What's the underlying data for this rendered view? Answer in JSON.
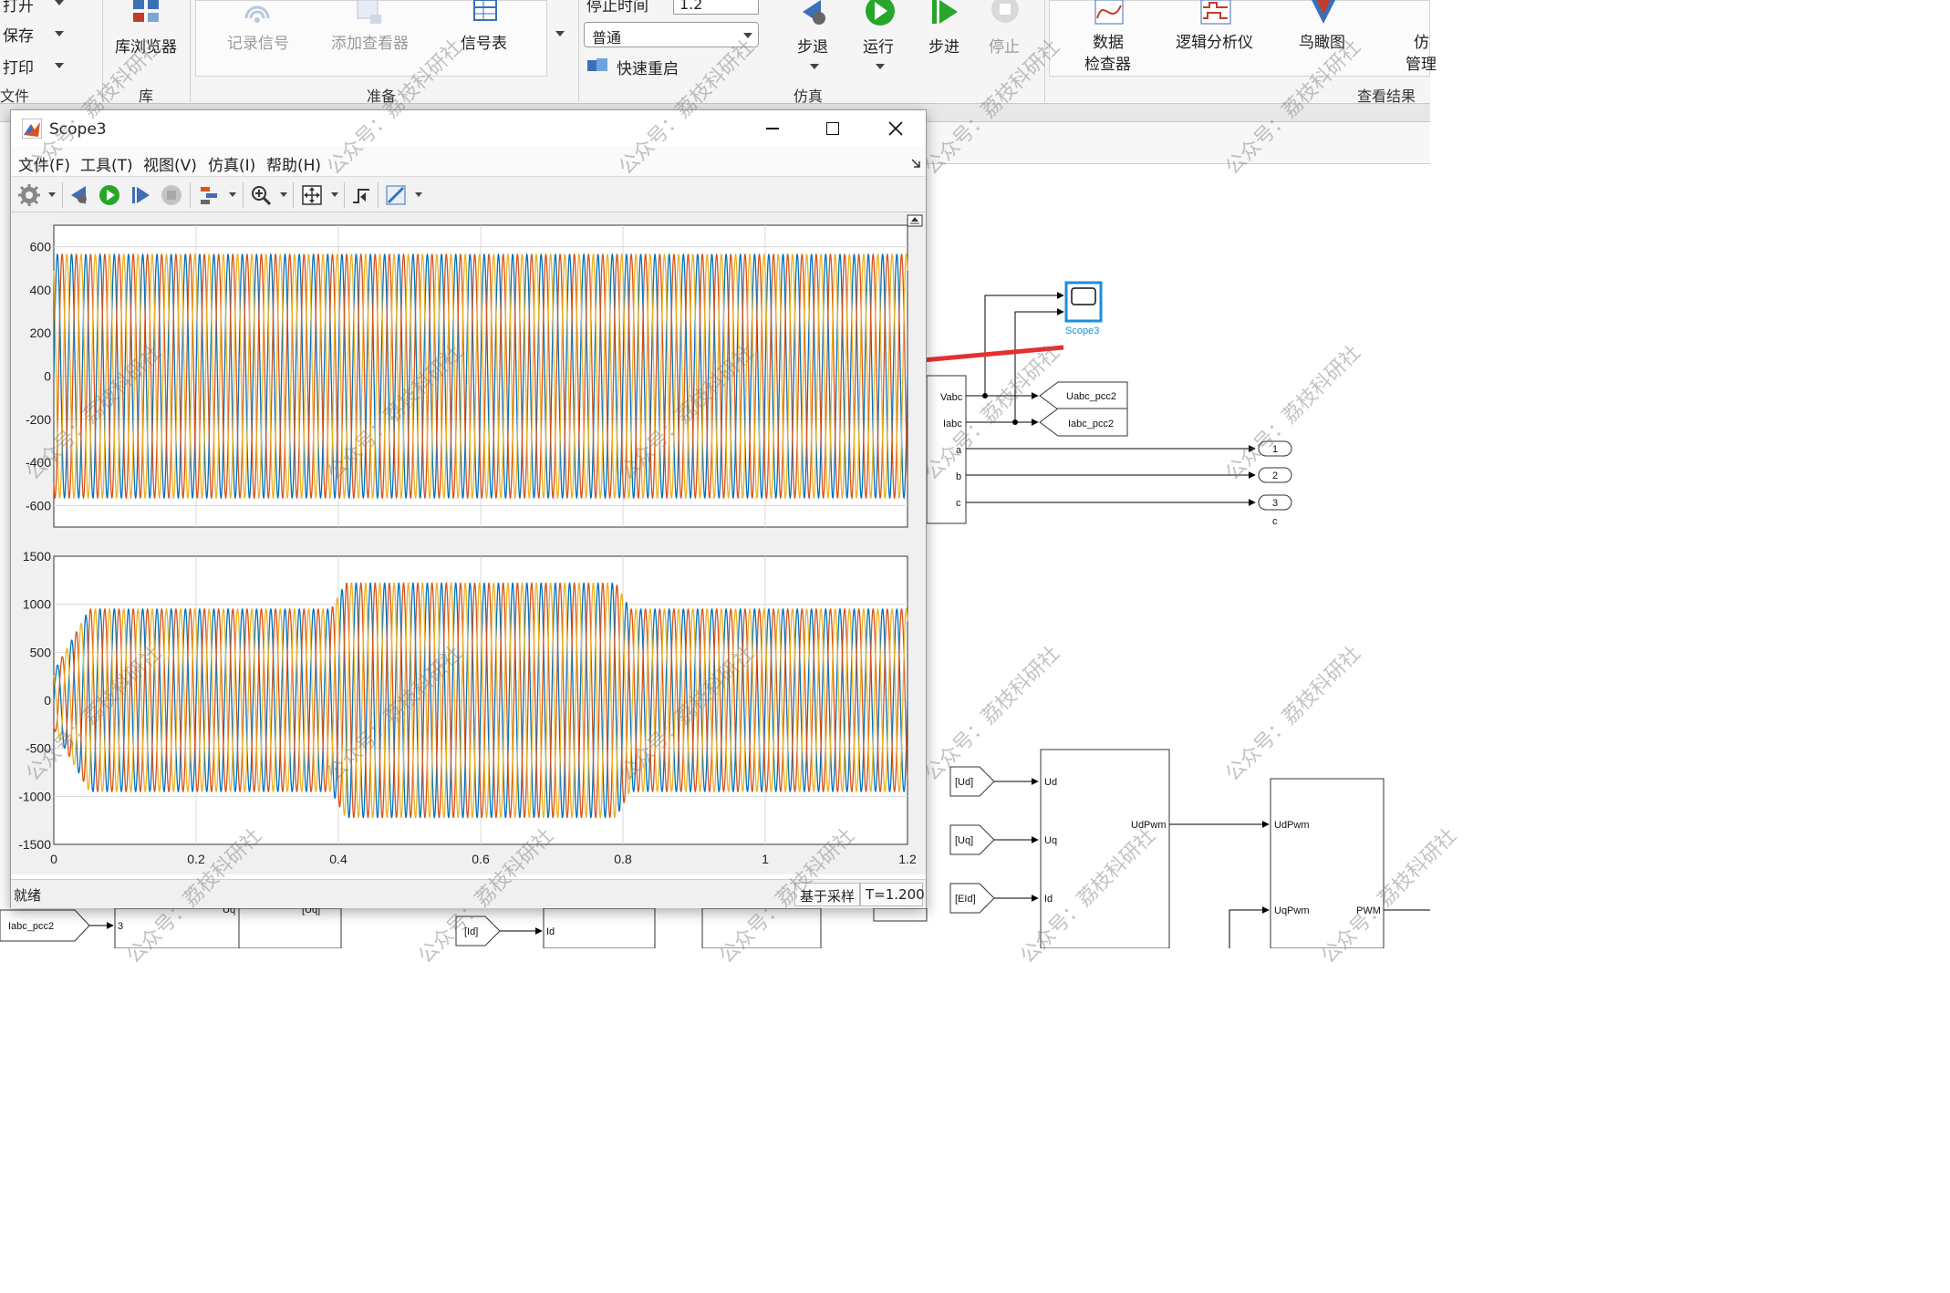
{
  "ribbon": {
    "open_label": "打开",
    "save_label": "保存",
    "print_label": "打印",
    "file_section": "文件",
    "lib_browser_label": "库浏览器",
    "lib_section": "库",
    "record_signal_label": "记录信号",
    "add_viewer_label": "添加查看器",
    "signal_table_label": "信号表",
    "prepare_section": "准备",
    "stop_time_label": "停止时间",
    "stop_time_value": "1.2",
    "sim_mode_value": "普通",
    "fast_restart_label": "快速重启",
    "step_back_label": "步退",
    "run_label": "运行",
    "step_forward_label": "步进",
    "stop_label": "停止",
    "simulate_section": "仿真",
    "data_inspector_label_1": "数据",
    "data_inspector_label_2": "检查器",
    "logic_analyzer_label": "逻辑分析仪",
    "birds_eye_label": "鸟瞰图",
    "sim_manager_label_1": "仿",
    "sim_manager_label_2": "管理",
    "review_section": "查看结果"
  },
  "scope": {
    "title": "Scope3",
    "menu": [
      "文件(F)",
      "工具(T)",
      "视图(V)",
      "仿真(I)",
      "帮助(H)"
    ],
    "status_ready": "就绪",
    "sample_based": "基于采样",
    "time_display": "T=1.200"
  },
  "icons": {
    "settings": "gear-icon",
    "step_back": "step-back-icon",
    "run": "play-icon",
    "step_forward": "step-forward-icon",
    "stop": "stop-icon",
    "highlight": "signal-highlight-icon",
    "zoom": "zoom-in-icon",
    "autoscale": "autoscale-icon",
    "triggers": "trigger-icon",
    "measurements": "cursor-measurement-icon",
    "undock": "undock-icon"
  },
  "diagram": {
    "scope_block_label": "Scope3",
    "pcc_ports": [
      "Vabc",
      "Iabc",
      "a",
      "b",
      "c"
    ],
    "goto_tags": [
      "Uabc_pcc2",
      "Iabc_pcc2"
    ],
    "outports": [
      "1",
      "2",
      "3"
    ],
    "outport_c_label": "c",
    "from_tags": [
      "[Ud]",
      "[Uq]",
      "[EId]"
    ],
    "block1_inputs": [
      "Ud",
      "Uq",
      "Id"
    ],
    "block1_output": "UdPwm",
    "block2_inputs": [
      "UdPwm",
      "UqPwm"
    ],
    "block2_output": "PWM",
    "bottom_from_tag": "Iabc_pcc2",
    "bottom_port_3": "3",
    "bottom_id_tag": "[Id]",
    "bottom_id_port": "Id",
    "bottom_uq_tag": "[Uq]",
    "bottom_uq_port": "Uq"
  },
  "watermark": "公众号：荔枝科研社",
  "colors": {
    "series1": "#0072BD",
    "series2": "#D95319",
    "series3": "#EDB120",
    "highlight_blue": "#1a8fe0",
    "arrow_red": "#e53030"
  },
  "chart_data": [
    {
      "type": "line",
      "title": "",
      "xlabel": "",
      "ylabel": "",
      "xlim": [
        0,
        1.2
      ],
      "ylim": [
        -700,
        700
      ],
      "yticks": [
        -600,
        -400,
        -200,
        0,
        200,
        400,
        600
      ],
      "grid": true,
      "series": [
        {
          "color": "#0072BD",
          "frequency_hz": 50,
          "phase_deg": 0,
          "amplitude": [
            [
              0,
              565
            ],
            [
              1.2,
              565
            ]
          ]
        },
        {
          "color": "#D95319",
          "frequency_hz": 50,
          "phase_deg": -120,
          "amplitude": [
            [
              0,
              565
            ],
            [
              1.2,
              565
            ]
          ]
        },
        {
          "color": "#EDB120",
          "frequency_hz": 50,
          "phase_deg": 120,
          "amplitude": [
            [
              0,
              565
            ],
            [
              1.2,
              565
            ]
          ]
        }
      ]
    },
    {
      "type": "line",
      "title": "",
      "xlabel": "",
      "ylabel": "",
      "xlim": [
        0,
        1.2
      ],
      "xticks": [
        0,
        0.2,
        0.4,
        0.6,
        0.8,
        1,
        1.2
      ],
      "ylim": [
        -1500,
        1500
      ],
      "yticks": [
        -1500,
        -1000,
        -500,
        0,
        500,
        1000,
        1500
      ],
      "grid": true,
      "series": [
        {
          "color": "#0072BD",
          "frequency_hz": 50,
          "phase_deg": 0,
          "amplitude": [
            [
              0,
              300
            ],
            [
              0.05,
              950
            ],
            [
              0.39,
              950
            ],
            [
              0.41,
              1220
            ],
            [
              0.79,
              1220
            ],
            [
              0.81,
              950
            ],
            [
              1.2,
              950
            ]
          ]
        },
        {
          "color": "#D95319",
          "frequency_hz": 50,
          "phase_deg": -120,
          "amplitude": [
            [
              0,
              300
            ],
            [
              0.05,
              950
            ],
            [
              0.39,
              950
            ],
            [
              0.41,
              1220
            ],
            [
              0.79,
              1220
            ],
            [
              0.81,
              950
            ],
            [
              1.2,
              950
            ]
          ]
        },
        {
          "color": "#EDB120",
          "frequency_hz": 50,
          "phase_deg": 120,
          "amplitude": [
            [
              0,
              300
            ],
            [
              0.05,
              950
            ],
            [
              0.39,
              950
            ],
            [
              0.41,
              1220
            ],
            [
              0.79,
              1220
            ],
            [
              0.81,
              950
            ],
            [
              1.2,
              950
            ]
          ]
        }
      ]
    }
  ]
}
